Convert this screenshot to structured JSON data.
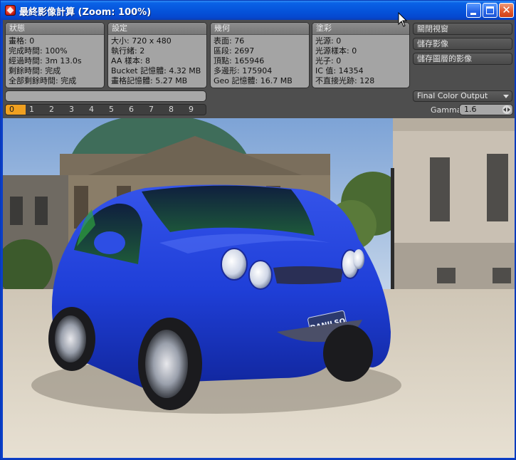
{
  "window": {
    "title": "最終影像計算 (Zoom: 100%)"
  },
  "groups": {
    "status": {
      "header": "狀態",
      "rows": [
        "畫格: 0",
        "完成時間: 100%",
        "經過時間: 3m 13.0s",
        "剩餘時間: 完成",
        "全部剩餘時間: 完成"
      ]
    },
    "settings": {
      "header": "設定",
      "rows": [
        "大小: 720 x 480",
        "執行緒: 2",
        "AA 樣本: 8",
        "Bucket 記憶體: 4.32 MB",
        "畫格記憶體: 5.27 MB"
      ]
    },
    "geometry": {
      "header": "幾何",
      "rows": [
        "表面: 76",
        "區段: 2697",
        "頂點: 165946",
        "多邊形: 175904",
        "Geo 記憶體: 16.7 MB"
      ]
    },
    "shading": {
      "header": "塗彩",
      "rows": [
        "光源: 0",
        "光源樣本: 0",
        "光子: 0",
        "IC 值: 14354",
        "不直接光跡: 128"
      ]
    }
  },
  "side_buttons": [
    "關閉視窗",
    "儲存影像",
    "儲存圖層的影像"
  ],
  "progress": {
    "value": 0.0
  },
  "buckets": {
    "items": [
      "0",
      "1",
      "2",
      "3",
      "4",
      "5",
      "6",
      "7",
      "8",
      "9"
    ],
    "active": "0"
  },
  "output": {
    "selected": "Final Color Output"
  },
  "gamma": {
    "label": "Gamma",
    "value": "1.6"
  },
  "render": {
    "plate_text": "DANILSO",
    "car_color": "#1f3fd8"
  },
  "colors": {
    "titlebar": "#0553da",
    "panel": "#4e4e4e",
    "group": "#a4a4a4",
    "accent": "#f0a020"
  }
}
